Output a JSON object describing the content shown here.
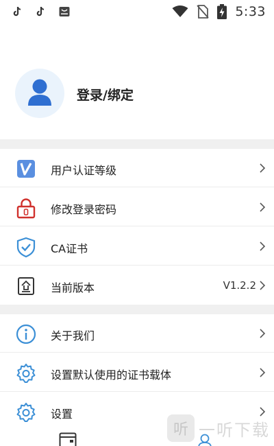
{
  "status_bar": {
    "time": "5:33",
    "left_icons": [
      "tiktok-icon",
      "tiktok-icon",
      "app-notification-icon"
    ],
    "right_icons": [
      "wifi-icon",
      "no-sim-icon",
      "battery-charging-icon"
    ]
  },
  "profile": {
    "login_label": "登录/绑定",
    "avatar_icon": "user-icon"
  },
  "menu_group_1": [
    {
      "label": "用户认证等级",
      "icon": "verification-level-icon",
      "icon_color": "#4a86d9"
    },
    {
      "label": "修改登录密码",
      "icon": "lock-icon",
      "icon_color": "#d0302c"
    },
    {
      "label": "CA证书",
      "icon": "shield-check-icon",
      "icon_color": "#3b8fd6"
    },
    {
      "label": "当前版本",
      "value": "V1.2.2",
      "icon": "upgrade-icon",
      "icon_color": "#333333"
    }
  ],
  "menu_group_2": [
    {
      "label": "关于我们",
      "icon": "info-icon",
      "icon_color": "#3b8fd6"
    },
    {
      "label": "设置默认使用的证书载体",
      "icon": "gear-icon",
      "icon_color": "#3b8fd6"
    },
    {
      "label": "设置",
      "icon": "gear-icon",
      "icon_color": "#3b8fd6"
    }
  ],
  "tab_bar": {
    "icons": [
      "wallet-icon",
      "user-tab-icon"
    ]
  },
  "watermark": {
    "box_glyph": "听",
    "text": "一听下载"
  },
  "colors": {
    "accent": "#3b8fd6",
    "avatar_bg": "#eaf3fc",
    "separator": "#f0f0f0"
  }
}
